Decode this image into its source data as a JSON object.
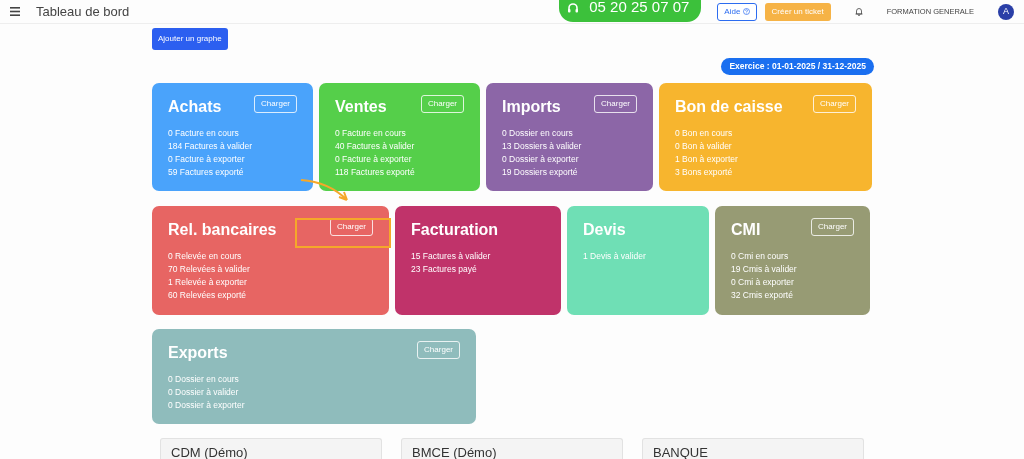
{
  "header": {
    "title": "Tableau de bord",
    "phone": "05 20 25 07 07",
    "help_button": "Aide",
    "ticket_button": "Créer un ticket",
    "company": "FORMATION GENERALE",
    "avatar": "A"
  },
  "add_chart_button": "Ajouter un graphe",
  "fiscal_year": "Exercice : 01-01-2025 / 31-12-2025",
  "card_rows": [
    [
      {
        "title": "Achats",
        "color": "#4aa3fb",
        "button": "Charger",
        "highlighted": false,
        "lines": [
          "0 Facture en cours",
          "184 Factures à valider",
          "0 Facture à exporter",
          "59 Factures exporté"
        ]
      },
      {
        "title": "Ventes",
        "color": "#55cf4a",
        "button": "Charger",
        "highlighted": false,
        "lines": [
          "0 Facture en cours",
          "40 Factures à valider",
          "0 Facture à exporter",
          "118 Factures exporté"
        ]
      },
      {
        "title": "Imports",
        "color": "#8c66a7",
        "button": "Charger",
        "highlighted": false,
        "lines": [
          "0 Dossier en cours",
          "13 Dossiers à valider",
          "0 Dossier à exporter",
          "19 Dossiers exporté"
        ]
      },
      {
        "title": "Bon de caisse",
        "color": "#f7b52e",
        "button": "Charger",
        "highlighted": false,
        "lines": [
          "0 Bon en cours",
          "0 Bon à valider",
          "1 Bon à exporter",
          "3 Bons exporté"
        ]
      }
    ],
    [
      {
        "title": "Rel. bancaires",
        "color": "#e76563",
        "button": "Charger",
        "highlighted": true,
        "lines": [
          "0 Relevée en cours",
          "70 Relevées à valider",
          "1 Relevée à exporter",
          "60 Relevées exporté"
        ]
      },
      {
        "title": "Facturation",
        "color": "#c0336a",
        "highlighted": false,
        "lines": [
          "15 Factures à valider",
          "23 Factures payé"
        ]
      },
      {
        "title": "Devis",
        "color": "#6fdfb5",
        "highlighted": false,
        "lines": [
          "1 Devis à valider"
        ]
      },
      {
        "title": "CMI",
        "color": "#979b74",
        "button": "Charger",
        "highlighted": false,
        "lines": [
          "0 Cmi en cours",
          "19 Cmis à valider",
          "0 Cmi à exporter",
          "32 Cmis exporté"
        ]
      }
    ],
    [
      {
        "title": "Exports",
        "color": "#8fbcbc",
        "button": "Charger",
        "highlighted": false,
        "lines": [
          "0 Dossier en cours",
          "0 Dossier à valider",
          "0 Dossier à exporter"
        ]
      }
    ]
  ],
  "bank_panels": [
    "CDM (Démo)",
    "BMCE (Démo)",
    "BANQUE"
  ]
}
